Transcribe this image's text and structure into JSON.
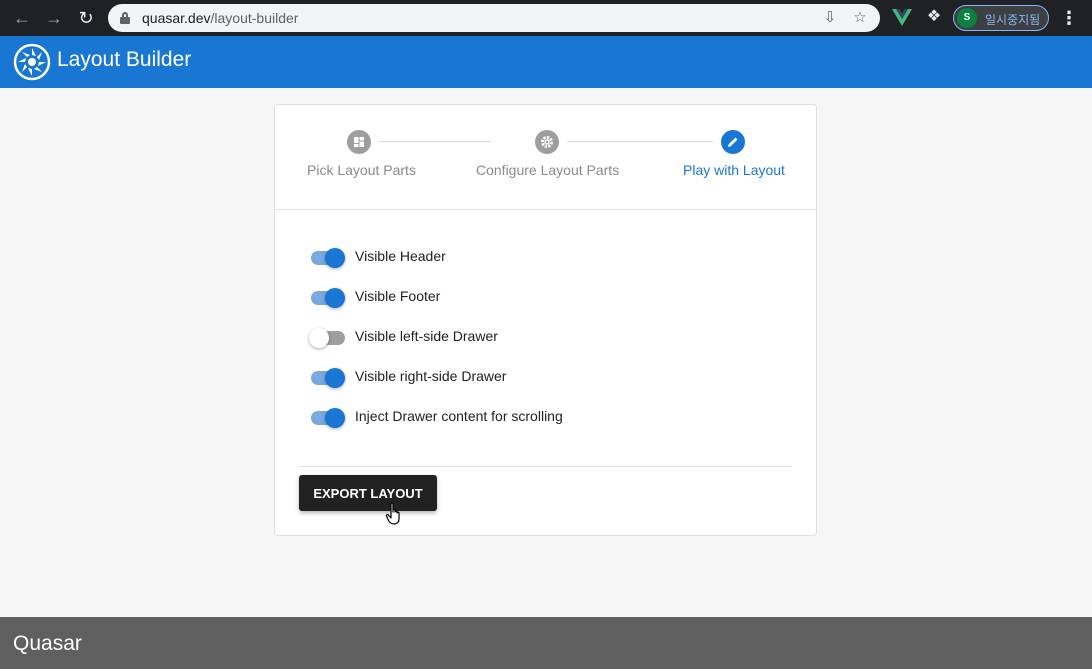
{
  "browser": {
    "url_host": "quasar.dev",
    "url_path": "/layout-builder",
    "profile_initial": "S",
    "profile_label": "일시중지됨"
  },
  "header": {
    "title": "Layout Builder"
  },
  "stepper": {
    "steps": [
      {
        "label": "Pick Layout Parts",
        "icon": "dashboard-icon",
        "active": false
      },
      {
        "label": "Configure Layout Parts",
        "icon": "gear-icon",
        "active": false
      },
      {
        "label": "Play with Layout",
        "icon": "pencil-icon",
        "active": true
      }
    ]
  },
  "toggles": [
    {
      "label": "Visible Header",
      "on": true
    },
    {
      "label": "Visible Footer",
      "on": true
    },
    {
      "label": "Visible left-side Drawer",
      "on": false
    },
    {
      "label": "Visible right-side Drawer",
      "on": true
    },
    {
      "label": "Inject Drawer content for scrolling",
      "on": true
    }
  ],
  "export_button": "EXPORT LAYOUT",
  "footer": {
    "title": "Quasar"
  },
  "colors": {
    "primary": "#1976d2",
    "footer": "#5f5f5f",
    "dark_button": "#212121"
  }
}
